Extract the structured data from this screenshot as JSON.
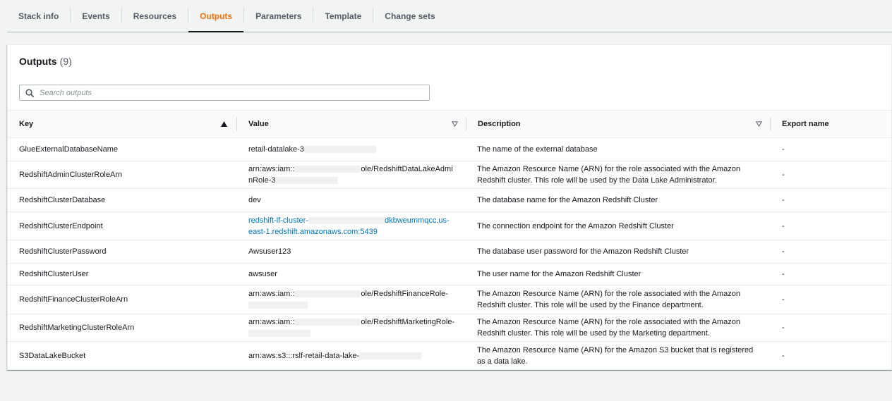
{
  "tabs": [
    "Stack info",
    "Events",
    "Resources",
    "Outputs",
    "Parameters",
    "Template",
    "Change sets"
  ],
  "active_tab": "Outputs",
  "accent_color": "#ec7211",
  "link_color": "#0073bb",
  "panel": {
    "title": "Outputs",
    "count": "(9)"
  },
  "search": {
    "placeholder": "Search outputs",
    "value": ""
  },
  "table": {
    "columns": {
      "key": "Key",
      "value": "Value",
      "description": "Description",
      "export": "Export name"
    },
    "rows": [
      {
        "key": "GlueExternalDatabaseName",
        "value_parts": [
          "retail-datalake-3",
          "",
          ""
        ],
        "description": "The name of the external database",
        "export": "-"
      },
      {
        "key": "RedshiftAdminClusterRoleArn",
        "value_parts": [
          "arn:aws:iam::",
          "ole/RedshiftDataLakeAdmi",
          "nRole-3"
        ],
        "description": "The Amazon Resource Name (ARN) for the role associated with the Amazon Redshift cluster. This role will be used by the Data Lake Administrator.",
        "export": "-"
      },
      {
        "key": "RedshiftClusterDatabase",
        "value_parts": [
          "dev"
        ],
        "description": "The database name for the Amazon Redshift Cluster",
        "export": "-"
      },
      {
        "key": "RedshiftClusterEndpoint",
        "value_parts": [
          "redshift-lf-cluster-",
          "dkbweummqcc.us-",
          "east-1.redshift.amazonaws.com:5439"
        ],
        "description": "The connection endpoint for the Amazon Redshift Cluster",
        "export": "-"
      },
      {
        "key": "RedshiftClusterPassword",
        "value_parts": [
          "Awsuser123"
        ],
        "description": "The database user password for the Amazon Redshift Cluster",
        "export": "-"
      },
      {
        "key": "RedshiftClusterUser",
        "value_parts": [
          "awsuser"
        ],
        "description": "The user name for the Amazon Redshift Cluster",
        "export": "-"
      },
      {
        "key": "RedshiftFinanceClusterRoleArn",
        "value_parts": [
          "arn:aws:iam::",
          "ole/RedshiftFinanceRole-"
        ],
        "description": "The Amazon Resource Name (ARN) for the role associated with the Amazon Redshift cluster. This role will be used by the Finance department.",
        "export": "-"
      },
      {
        "key": "RedshiftMarketingClusterRoleArn",
        "value_parts": [
          "arn:aws:iam::",
          "ole/RedshiftMarketingRole-"
        ],
        "description": "The Amazon Resource Name (ARN) for the role associated with the Amazon Redshift cluster. This role will be used by the Marketing department.",
        "export": "-"
      },
      {
        "key": "S3DataLakeBucket",
        "value_parts": [
          "arn:aws:s3:::rslf-retail-data-lake-"
        ],
        "description": "The Amazon Resource Name (ARN) for the Amazon S3 bucket that is registered as a data lake.",
        "export": "-"
      }
    ]
  }
}
